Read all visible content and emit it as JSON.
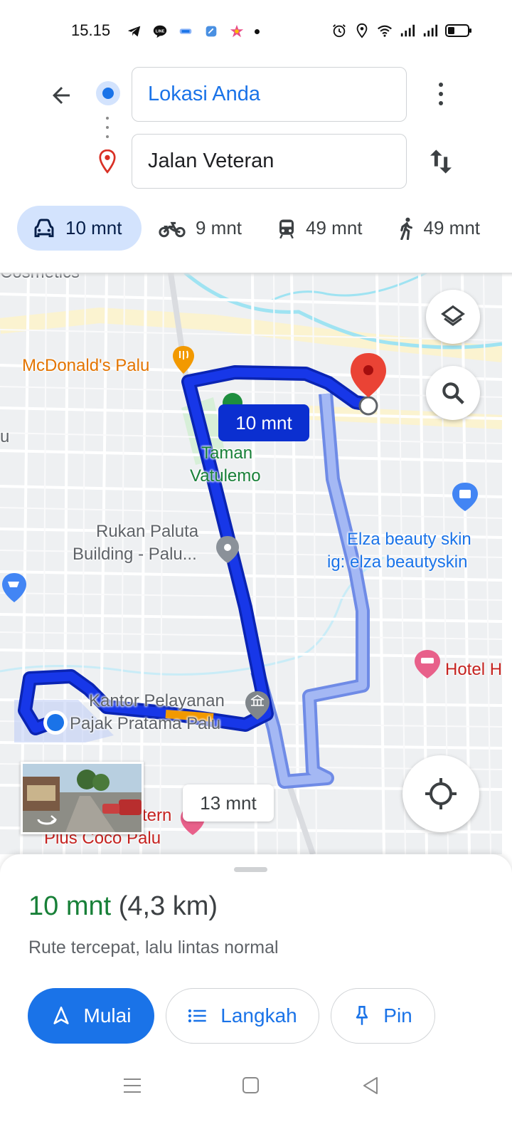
{
  "status_bar": {
    "time": "15.15",
    "icons_left": [
      "telegram-icon",
      "line-icon",
      "app-icon",
      "files-icon",
      "photos-icon",
      "notification-dot"
    ],
    "icons_right": [
      "alarm-icon",
      "location-icon",
      "wifi-icon",
      "signal-icon",
      "signal-icon",
      "battery-icon"
    ]
  },
  "header": {
    "origin": "Lokasi Anda",
    "destination": "Jalan Veteran"
  },
  "modes": [
    {
      "icon": "car-icon",
      "label": "10 mnt",
      "active": true
    },
    {
      "icon": "motorbike-icon",
      "label": "9 mnt",
      "active": false
    },
    {
      "icon": "transit-icon",
      "label": "49 mnt",
      "active": false
    },
    {
      "icon": "walk-icon",
      "label": "49 mnt",
      "active": false
    }
  ],
  "map": {
    "labels": {
      "cosmetics": "Cosmetics",
      "mcdonalds": "McDonald's Palu",
      "taman_1": "Taman",
      "taman_2": "Vatulemo",
      "rukan_1": "Rukan Paluta",
      "rukan_2": "Building - Palu...",
      "elza_1": "Elza beauty skin",
      "elza_2": "ig: elza beautyskin",
      "hotel": "Hotel H",
      "kantor_1": "Kantor Pelayanan",
      "kantor_2": "Pajak Pratama Palu",
      "coco_1": "tern",
      "coco_2": "Plus Coco Palu",
      "left_edge": "u"
    },
    "eta_primary": "10 mnt",
    "eta_alternate": "13 mnt",
    "colors": {
      "primary_route": "#0b2fd0",
      "alternate_route": "#a4b8f4",
      "traffic_slow": "#f29900",
      "destination_pin": "#ea4335"
    }
  },
  "sheet": {
    "duration": "10 mnt",
    "distance": "(4,3 km)",
    "description": "Rute tercepat, lalu lintas normal",
    "start_label": "Mulai",
    "steps_label": "Langkah",
    "pin_label": "Pin"
  },
  "colors": {
    "accent": "#1a73e8",
    "duration_green": "#188038",
    "active_tab": "#d3e3fd"
  }
}
